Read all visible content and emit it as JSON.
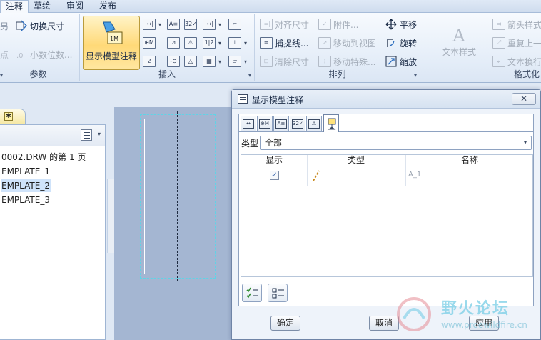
{
  "ribbon": {
    "tabs": [
      "注释",
      "草绘",
      "审阅",
      "发布"
    ],
    "active_tab": "注释",
    "groups": {
      "params": {
        "label": "参数",
        "toggle_dimension": "切换尺寸",
        "decimal_places": "小数位数..."
      },
      "insert": {
        "label": "插入",
        "show_model_annotations": "显示模型注释"
      },
      "arrange": {
        "label": "排列",
        "align_dimension": "对齐尺寸",
        "attach": "附件...",
        "capture_lines": "捕捉线...",
        "move_to_view": "移动到视图",
        "clear_dimension": "清除尺寸",
        "move_special": "移动特殊...",
        "pan": "平移",
        "rotate": "旋转",
        "scale": "缩放"
      },
      "format": {
        "label": "格式化",
        "text_style": "文本样式",
        "arrow_style": "箭头样式",
        "repeat_last": "重复上一",
        "text_wrap": "文本换行"
      }
    }
  },
  "tree": {
    "items": [
      "0002.DRW 的第 1 页",
      "EMPLATE_1",
      "EMPLATE_2",
      "EMPLATE_3"
    ],
    "selected_index": 2
  },
  "dialog": {
    "title": "显示模型注释",
    "close_label": "✕",
    "tabs": [
      {
        "icon": "dimension-tab-icon",
        "glyph": "↔"
      },
      {
        "icon": "geometric-tolerance-tab-icon",
        "glyph": "⊕M"
      },
      {
        "icon": "note-tab-icon",
        "glyph": "A≡"
      },
      {
        "icon": "surface-finish-tab-icon",
        "glyph": "32✓"
      },
      {
        "icon": "symbol-tab-icon",
        "glyph": "⚠"
      },
      {
        "icon": "datum-tab-icon",
        "glyph": "⊥"
      }
    ],
    "active_tab_index": 5,
    "type_label": "类型",
    "type_value": "全部",
    "columns": {
      "show": "显示",
      "type": "类型",
      "name": "名称"
    },
    "rows": [
      {
        "show": true,
        "type_icon": "datum-axis-icon",
        "name": "A_1"
      }
    ],
    "ok_label": "确定",
    "cancel_label": "取消",
    "apply_label": "应用"
  },
  "watermark": {
    "text": "野火论坛",
    "url": "www.proewildfire.cn"
  }
}
